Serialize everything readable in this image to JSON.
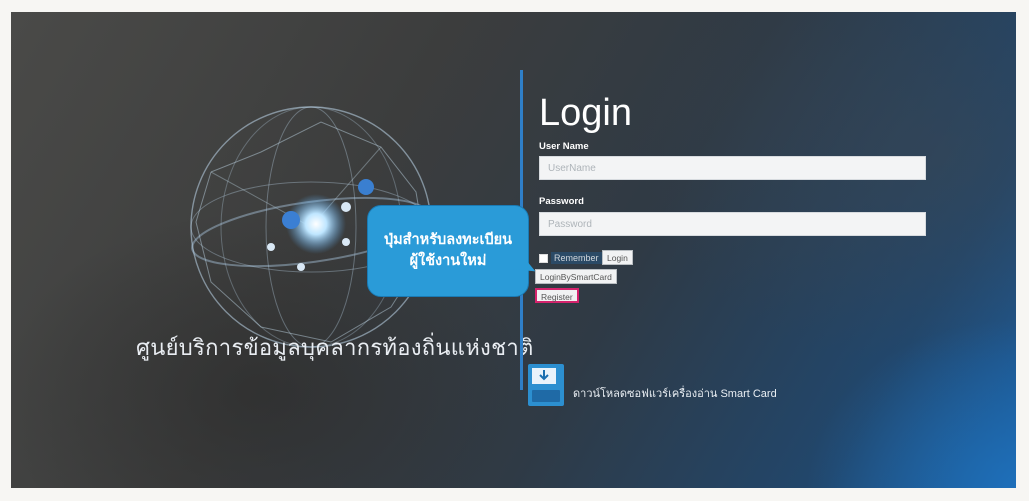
{
  "brand": {
    "org_name": "ศูนย์บริการข้อมูลบุคลากรท้องถิ่นแห่งชาติ"
  },
  "callout": {
    "line1": "ปุ่มสำหรับลงทะเบียน",
    "line2": "ผู้ใช้งานใหม่"
  },
  "login": {
    "title": "Login",
    "username_label": "User Name",
    "username_placeholder": "UserName",
    "password_label": "Password",
    "password_placeholder": "Password",
    "remember_label": "Remember",
    "login_button": "Login",
    "smartcard_button": "LoginBySmartCard",
    "register_button": "Register"
  },
  "download": {
    "text": "ดาวน์โหลดซอฟแวร์เครื่องอ่าน Smart Card",
    "icon": "download-card-reader-icon"
  },
  "colors": {
    "accent_blue": "#2a9bd8",
    "divider": "#2f7fc8",
    "register_highlight": "#d4236d"
  }
}
